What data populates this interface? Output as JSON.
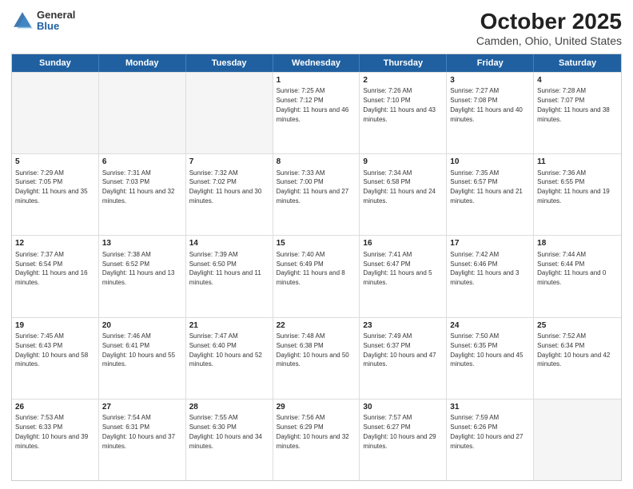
{
  "header": {
    "logo_general": "General",
    "logo_blue": "Blue",
    "title": "October 2025",
    "subtitle": "Camden, Ohio, United States"
  },
  "calendar": {
    "days_of_week": [
      "Sunday",
      "Monday",
      "Tuesday",
      "Wednesday",
      "Thursday",
      "Friday",
      "Saturday"
    ],
    "rows": [
      [
        {
          "day": "",
          "empty": true
        },
        {
          "day": "",
          "empty": true
        },
        {
          "day": "",
          "empty": true
        },
        {
          "day": "1",
          "sunrise": "7:25 AM",
          "sunset": "7:12 PM",
          "daylight": "11 hours and 46 minutes."
        },
        {
          "day": "2",
          "sunrise": "7:26 AM",
          "sunset": "7:10 PM",
          "daylight": "11 hours and 43 minutes."
        },
        {
          "day": "3",
          "sunrise": "7:27 AM",
          "sunset": "7:08 PM",
          "daylight": "11 hours and 40 minutes."
        },
        {
          "day": "4",
          "sunrise": "7:28 AM",
          "sunset": "7:07 PM",
          "daylight": "11 hours and 38 minutes."
        }
      ],
      [
        {
          "day": "5",
          "sunrise": "7:29 AM",
          "sunset": "7:05 PM",
          "daylight": "11 hours and 35 minutes."
        },
        {
          "day": "6",
          "sunrise": "7:31 AM",
          "sunset": "7:03 PM",
          "daylight": "11 hours and 32 minutes."
        },
        {
          "day": "7",
          "sunrise": "7:32 AM",
          "sunset": "7:02 PM",
          "daylight": "11 hours and 30 minutes."
        },
        {
          "day": "8",
          "sunrise": "7:33 AM",
          "sunset": "7:00 PM",
          "daylight": "11 hours and 27 minutes."
        },
        {
          "day": "9",
          "sunrise": "7:34 AM",
          "sunset": "6:58 PM",
          "daylight": "11 hours and 24 minutes."
        },
        {
          "day": "10",
          "sunrise": "7:35 AM",
          "sunset": "6:57 PM",
          "daylight": "11 hours and 21 minutes."
        },
        {
          "day": "11",
          "sunrise": "7:36 AM",
          "sunset": "6:55 PM",
          "daylight": "11 hours and 19 minutes."
        }
      ],
      [
        {
          "day": "12",
          "sunrise": "7:37 AM",
          "sunset": "6:54 PM",
          "daylight": "11 hours and 16 minutes."
        },
        {
          "day": "13",
          "sunrise": "7:38 AM",
          "sunset": "6:52 PM",
          "daylight": "11 hours and 13 minutes."
        },
        {
          "day": "14",
          "sunrise": "7:39 AM",
          "sunset": "6:50 PM",
          "daylight": "11 hours and 11 minutes."
        },
        {
          "day": "15",
          "sunrise": "7:40 AM",
          "sunset": "6:49 PM",
          "daylight": "11 hours and 8 minutes."
        },
        {
          "day": "16",
          "sunrise": "7:41 AM",
          "sunset": "6:47 PM",
          "daylight": "11 hours and 5 minutes."
        },
        {
          "day": "17",
          "sunrise": "7:42 AM",
          "sunset": "6:46 PM",
          "daylight": "11 hours and 3 minutes."
        },
        {
          "day": "18",
          "sunrise": "7:44 AM",
          "sunset": "6:44 PM",
          "daylight": "11 hours and 0 minutes."
        }
      ],
      [
        {
          "day": "19",
          "sunrise": "7:45 AM",
          "sunset": "6:43 PM",
          "daylight": "10 hours and 58 minutes."
        },
        {
          "day": "20",
          "sunrise": "7:46 AM",
          "sunset": "6:41 PM",
          "daylight": "10 hours and 55 minutes."
        },
        {
          "day": "21",
          "sunrise": "7:47 AM",
          "sunset": "6:40 PM",
          "daylight": "10 hours and 52 minutes."
        },
        {
          "day": "22",
          "sunrise": "7:48 AM",
          "sunset": "6:38 PM",
          "daylight": "10 hours and 50 minutes."
        },
        {
          "day": "23",
          "sunrise": "7:49 AM",
          "sunset": "6:37 PM",
          "daylight": "10 hours and 47 minutes."
        },
        {
          "day": "24",
          "sunrise": "7:50 AM",
          "sunset": "6:35 PM",
          "daylight": "10 hours and 45 minutes."
        },
        {
          "day": "25",
          "sunrise": "7:52 AM",
          "sunset": "6:34 PM",
          "daylight": "10 hours and 42 minutes."
        }
      ],
      [
        {
          "day": "26",
          "sunrise": "7:53 AM",
          "sunset": "6:33 PM",
          "daylight": "10 hours and 39 minutes."
        },
        {
          "day": "27",
          "sunrise": "7:54 AM",
          "sunset": "6:31 PM",
          "daylight": "10 hours and 37 minutes."
        },
        {
          "day": "28",
          "sunrise": "7:55 AM",
          "sunset": "6:30 PM",
          "daylight": "10 hours and 34 minutes."
        },
        {
          "day": "29",
          "sunrise": "7:56 AM",
          "sunset": "6:29 PM",
          "daylight": "10 hours and 32 minutes."
        },
        {
          "day": "30",
          "sunrise": "7:57 AM",
          "sunset": "6:27 PM",
          "daylight": "10 hours and 29 minutes."
        },
        {
          "day": "31",
          "sunrise": "7:59 AM",
          "sunset": "6:26 PM",
          "daylight": "10 hours and 27 minutes."
        },
        {
          "day": "",
          "empty": true
        }
      ]
    ]
  }
}
